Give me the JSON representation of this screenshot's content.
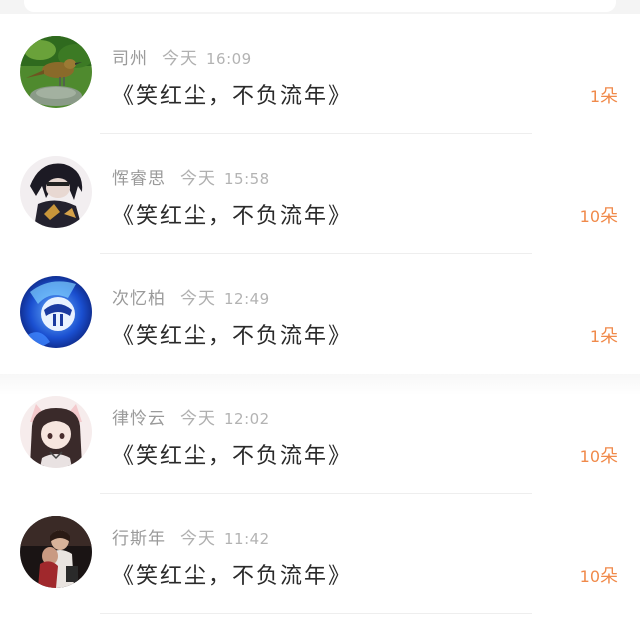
{
  "day_label": "今天",
  "unit_label": "朵",
  "records": [
    {
      "name": "司州",
      "time": "16:09",
      "message": "《笑红尘，不负流年》",
      "count": "1",
      "avatar": "bird-avatar"
    },
    {
      "name": "恽睿思",
      "time": "15:58",
      "message": "《笑红尘，不负流年》",
      "count": "10",
      "avatar": "dark-character-avatar"
    },
    {
      "name": "次忆柏",
      "time": "12:49",
      "message": "《笑红尘，不负流年》",
      "count": "1",
      "avatar": "blue-mask-avatar"
    },
    {
      "name": "律怜云",
      "time": "12:02",
      "message": "《笑红尘，不负流年》",
      "count": "10",
      "avatar": "anime-girl-avatar"
    },
    {
      "name": "行斯年",
      "time": "11:42",
      "message": "《笑红尘，不负流年》",
      "count": "10",
      "avatar": "couple-photo-avatar"
    }
  ],
  "colors": {
    "accent": "#f08a4b",
    "name_gray": "#9a9a9a",
    "message_text": "#2a2a2a",
    "background": "#f4f4f4"
  }
}
